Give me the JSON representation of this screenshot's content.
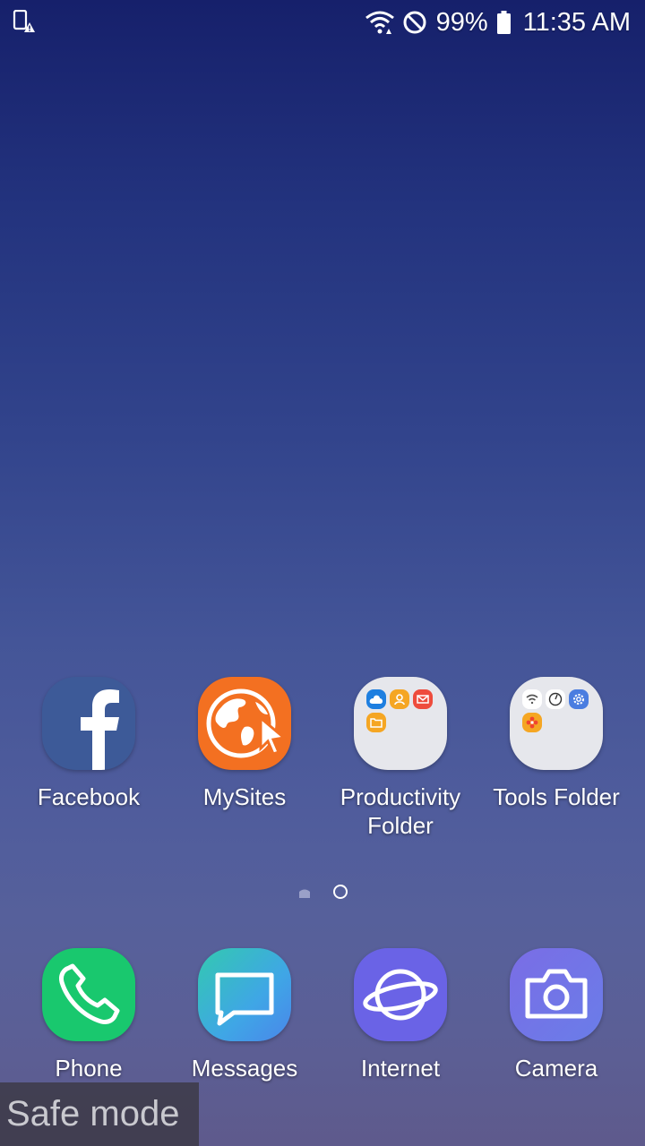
{
  "status_bar": {
    "left_icon": "phone-alert-icon",
    "icons": [
      "wifi-icon",
      "do-not-disturb-icon"
    ],
    "battery_percent": "99%",
    "battery_icon": "battery-icon",
    "time": "11:35 AM"
  },
  "apps": [
    {
      "label": "Facebook",
      "icon": "facebook-icon",
      "color": "#3d5a98"
    },
    {
      "label": "MySites",
      "icon": "globe-cursor-icon",
      "color": "#f37021"
    },
    {
      "label": "Productivity\nFolder",
      "icon": "folder-icon",
      "color": "#e6e7ec"
    },
    {
      "label": "Tools Folder",
      "icon": "folder-icon",
      "color": "#e6e7ec"
    }
  ],
  "page_indicator": {
    "pages": 2,
    "current": 2
  },
  "dock": [
    {
      "label": "Phone",
      "icon": "phone-icon",
      "color": "#19c86e"
    },
    {
      "label": "Messages",
      "icon": "message-icon",
      "color": "#3fa6e6"
    },
    {
      "label": "Internet",
      "icon": "planet-icon",
      "color": "#6a63e6"
    },
    {
      "label": "Camera",
      "icon": "camera-icon",
      "color": "#6a7de8"
    }
  ],
  "safe_mode": "Safe mode"
}
